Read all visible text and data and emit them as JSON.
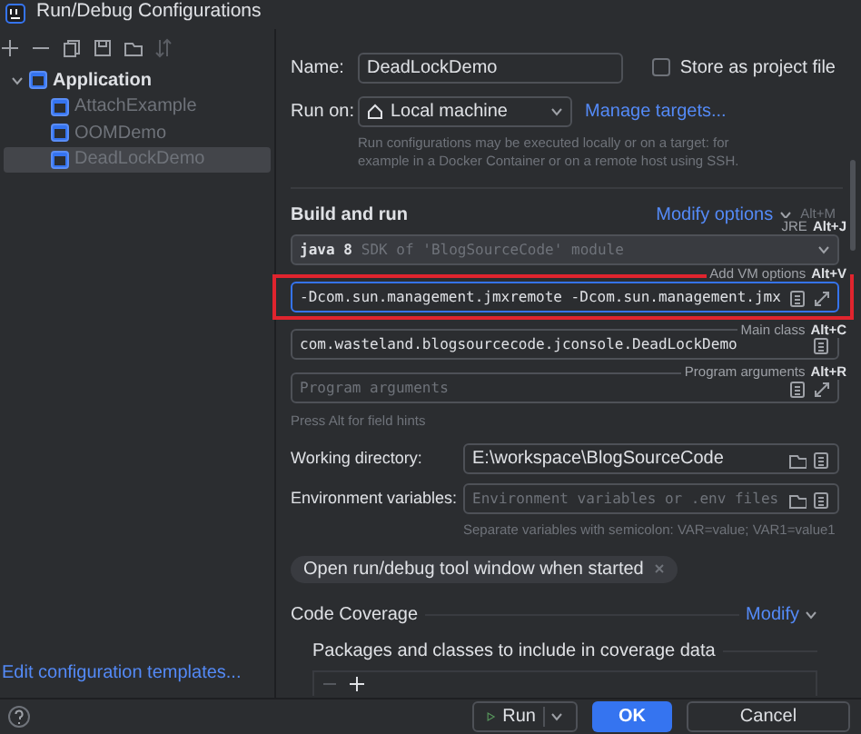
{
  "window": {
    "title": "Run/Debug Configurations"
  },
  "tree": [
    {
      "label": "Application",
      "expanded": true,
      "selected": false,
      "children": [
        {
          "label": "AttachExample",
          "selected": false
        },
        {
          "label": "OOMDemo",
          "selected": false
        },
        {
          "label": "DeadLockDemo",
          "selected": true
        }
      ]
    }
  ],
  "edit_templates_link": "Edit configuration templates...",
  "name_field": {
    "label": "Name:",
    "value": "DeadLockDemo"
  },
  "store_as_project_file": {
    "label": "Store as project file",
    "checked": false
  },
  "run_on": {
    "label": "Run on:",
    "value": "Local machine",
    "link": "Manage targets...",
    "hint": "Run configurations may be executed locally or on a target: for example in a Docker Container or on a remote host using SSH."
  },
  "build_and_run": {
    "title": "Build and run",
    "modify": "Modify options",
    "modify_shortcut": "Alt+M",
    "jre": {
      "value": "java 8",
      "hint": "SDK of 'BlogSourceCode' module"
    },
    "vm_options": {
      "value": "-Dcom.sun.management.jmxremote -Dcom.sun.management.jmx",
      "highlighted": true
    },
    "main_class": {
      "value": "com.wasteland.blogsourcecode.jconsole.DeadLockDemo"
    },
    "program_arguments": {
      "placeholder": "Program arguments"
    },
    "field_hint": "Press Alt for field hints",
    "tooltips": [
      {
        "label": "JRE",
        "shortcut": "Alt+J"
      },
      {
        "label": "Add VM options",
        "shortcut": "Alt+V"
      },
      {
        "label": "Main class",
        "shortcut": "Alt+C"
      },
      {
        "label": "Program arguments",
        "shortcut": "Alt+R"
      }
    ]
  },
  "working_directory": {
    "label": "Working directory:",
    "value": "E:\\workspace\\BlogSourceCode"
  },
  "environment_variables": {
    "label": "Environment variables:",
    "placeholder": "Environment variables or .env files",
    "hint": "Separate variables with semicolon: VAR=value; VAR1=value1"
  },
  "option_chip": "Open run/debug tool window when started",
  "code_coverage": {
    "title": "Code Coverage",
    "modify": "Modify",
    "packages_label": "Packages and classes to include in coverage data"
  },
  "buttons": [
    {
      "label": "Run",
      "kind": "split"
    },
    {
      "label": "OK",
      "kind": "default"
    },
    {
      "label": "Cancel",
      "kind": "plain"
    }
  ]
}
